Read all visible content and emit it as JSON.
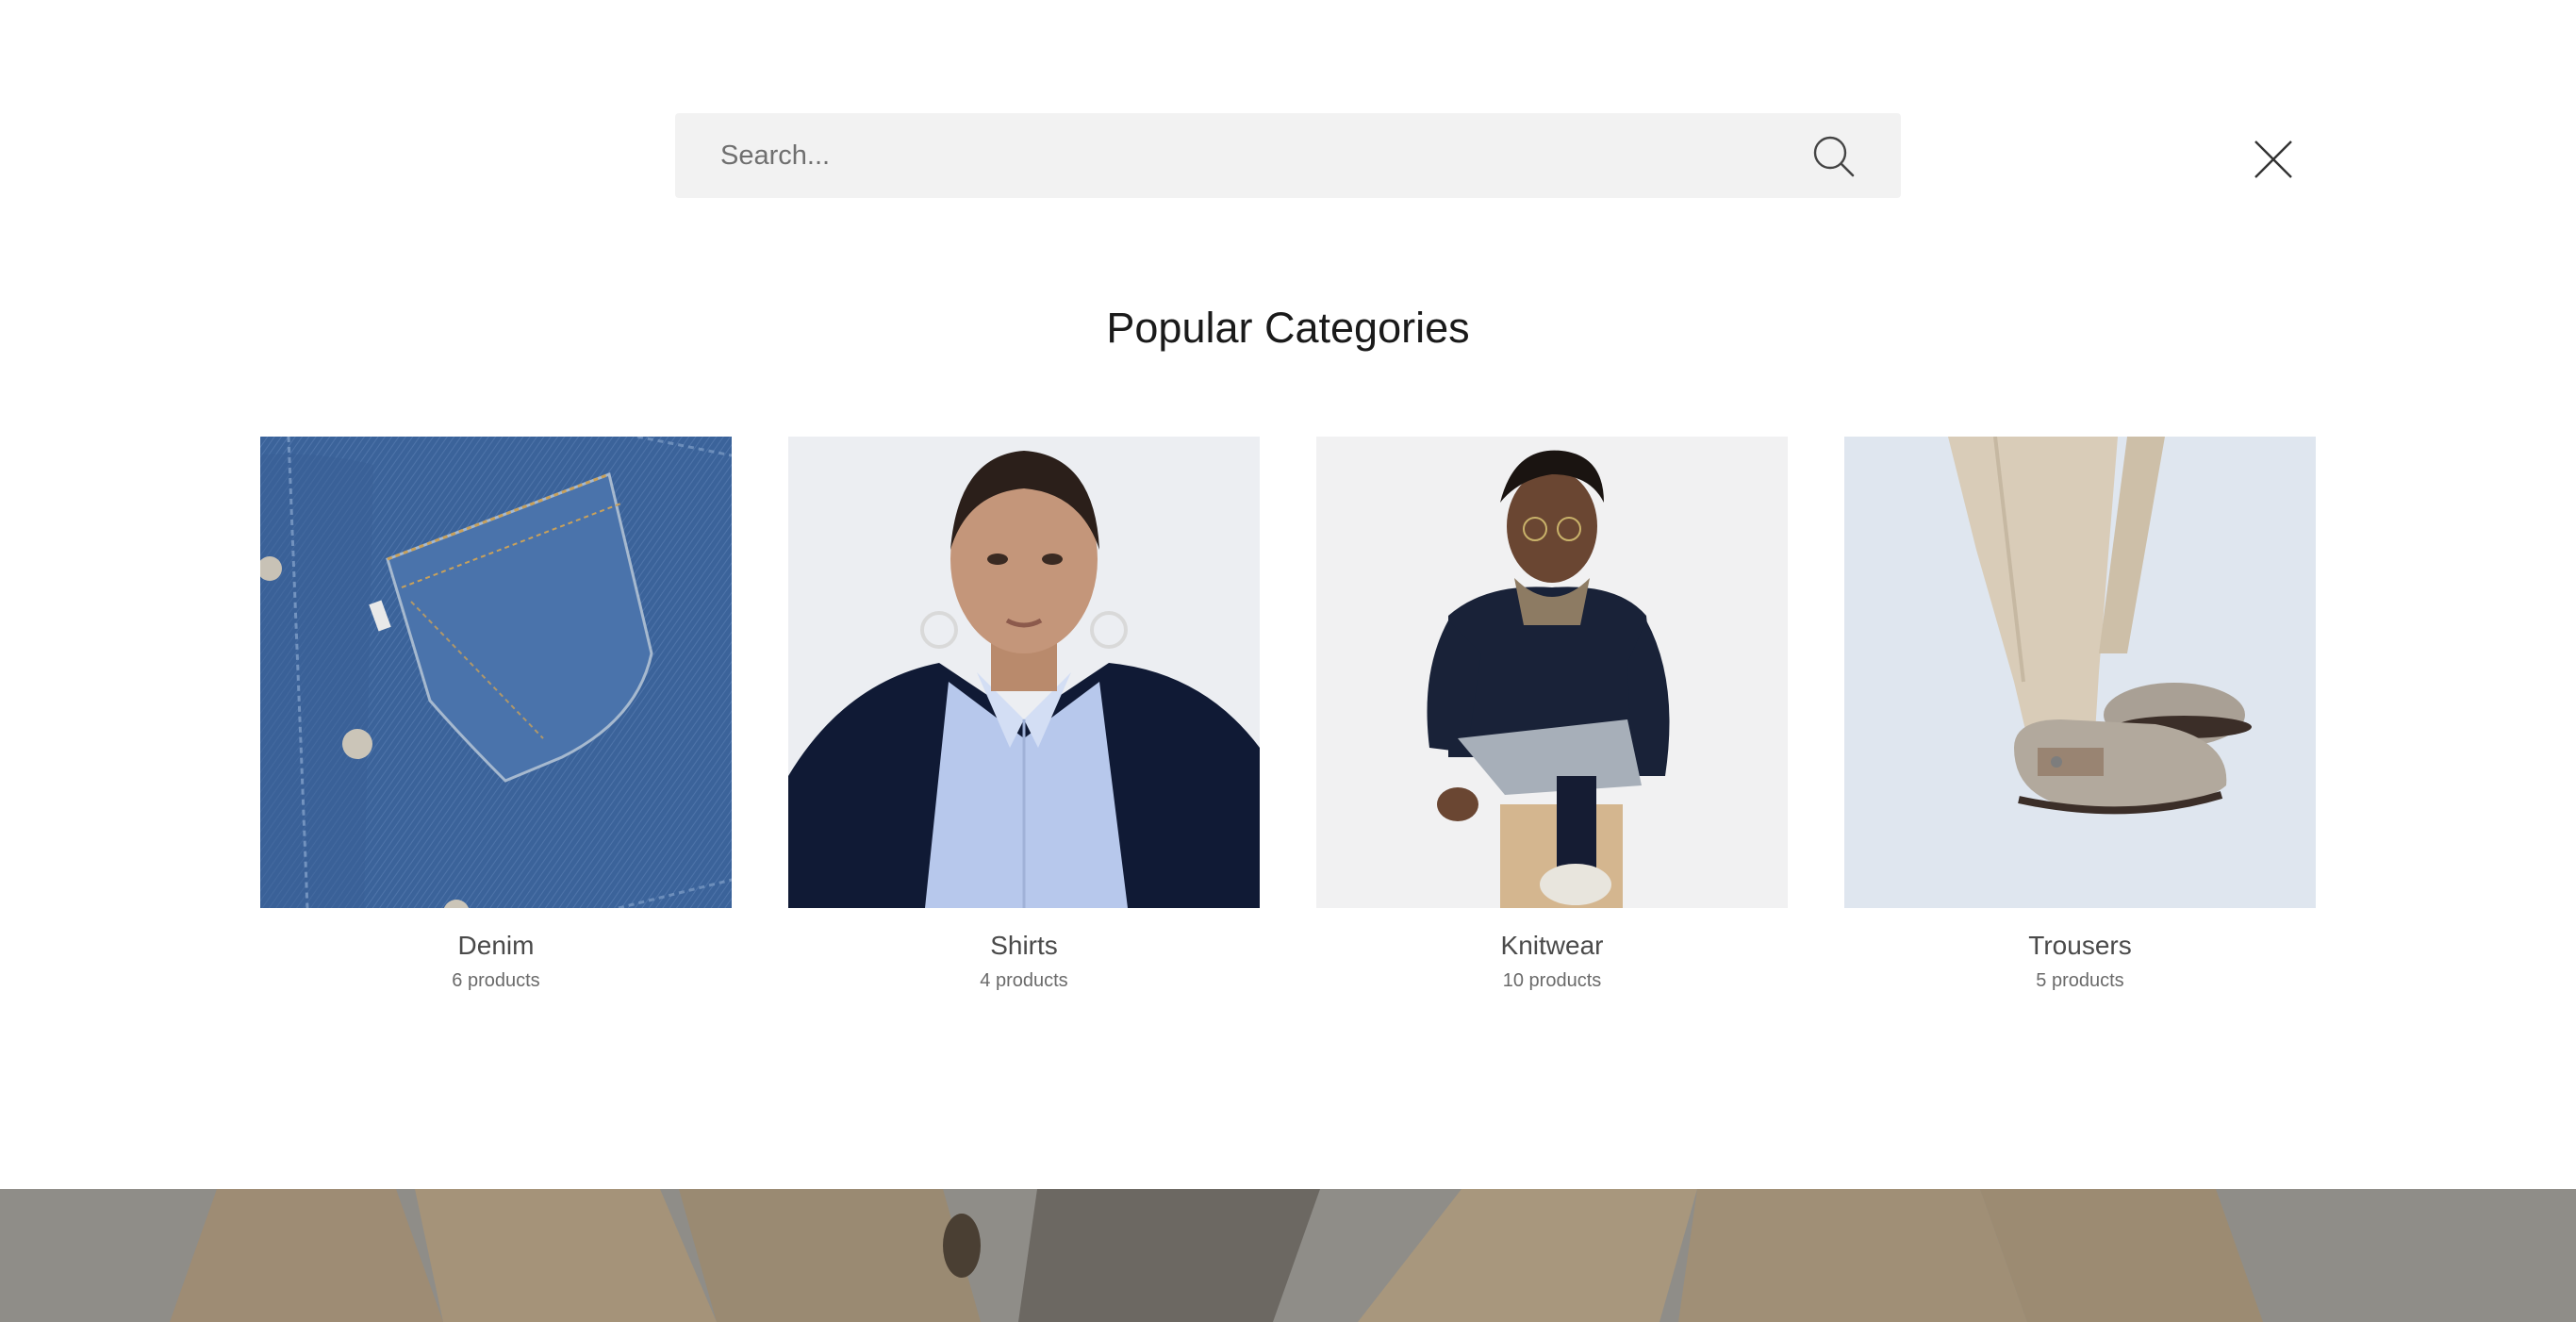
{
  "search": {
    "placeholder": "Search...",
    "value": ""
  },
  "icons": {
    "search": "search-icon",
    "close": "close-icon"
  },
  "popular": {
    "title": "Popular Categories",
    "categories": [
      {
        "name": "Denim",
        "count": "6 products"
      },
      {
        "name": "Shirts",
        "count": "4 products"
      },
      {
        "name": "Knitwear",
        "count": "10 products"
      },
      {
        "name": "Trousers",
        "count": "5 products"
      }
    ]
  },
  "colors": {
    "search_bg": "#f2f2f2",
    "text": "#1a1a1a",
    "muted": "#6a6a6a",
    "backdrop": "#8d8b86"
  }
}
